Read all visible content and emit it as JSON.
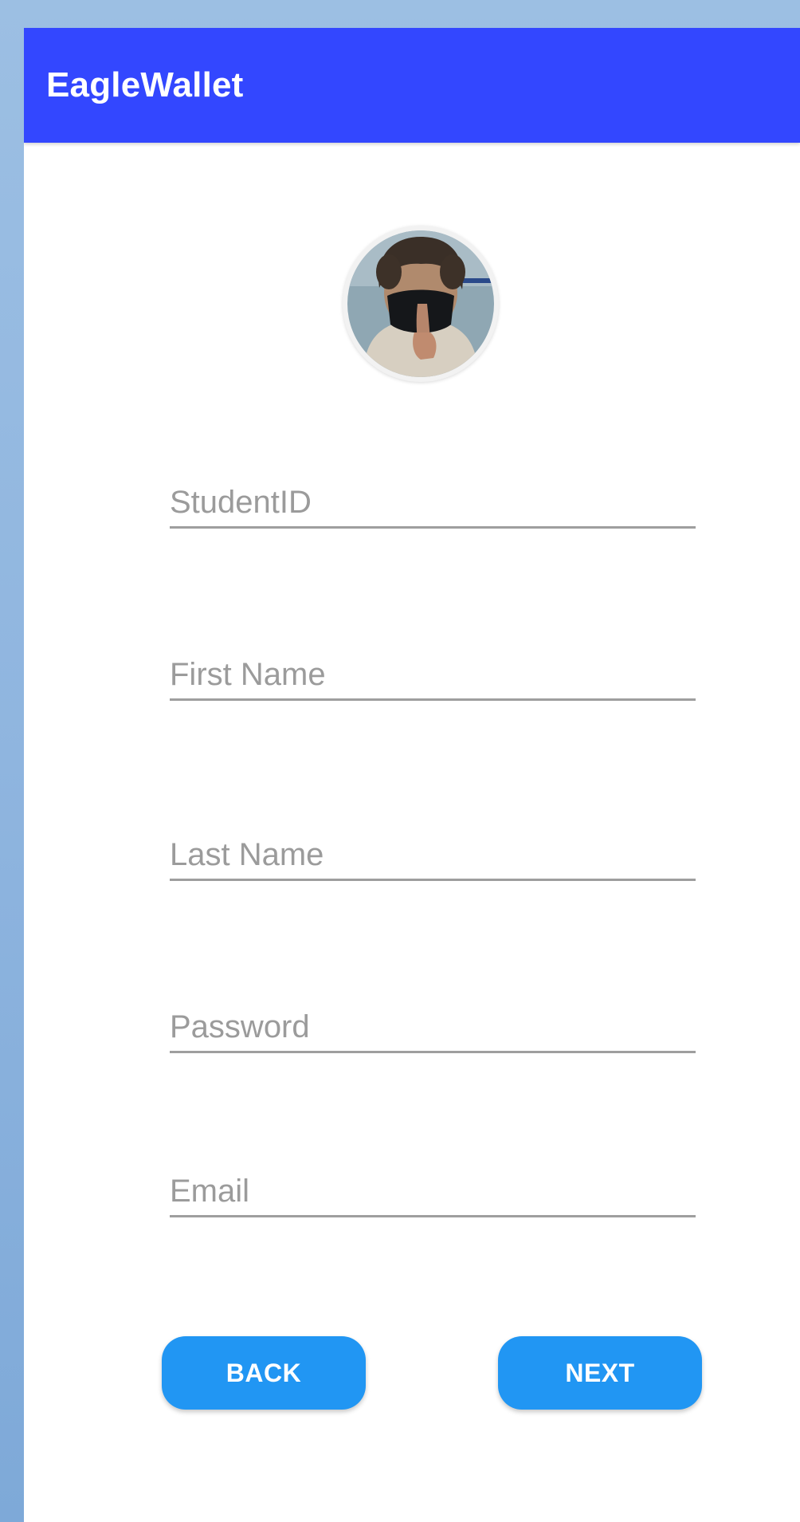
{
  "app": {
    "title": "EagleWallet",
    "accent_color": "#3347ff",
    "button_color": "#2196f3"
  },
  "profile": {
    "avatar_icon": "profile-photo"
  },
  "form": {
    "fields": [
      {
        "id": "student-id",
        "label": "StudentID"
      },
      {
        "id": "first-name",
        "label": "First Name"
      },
      {
        "id": "last-name",
        "label": "Last Name"
      },
      {
        "id": "password",
        "label": "Password"
      },
      {
        "id": "email",
        "label": "Email"
      }
    ]
  },
  "buttons": {
    "back_label": "BACK",
    "next_label": "NEXT"
  }
}
